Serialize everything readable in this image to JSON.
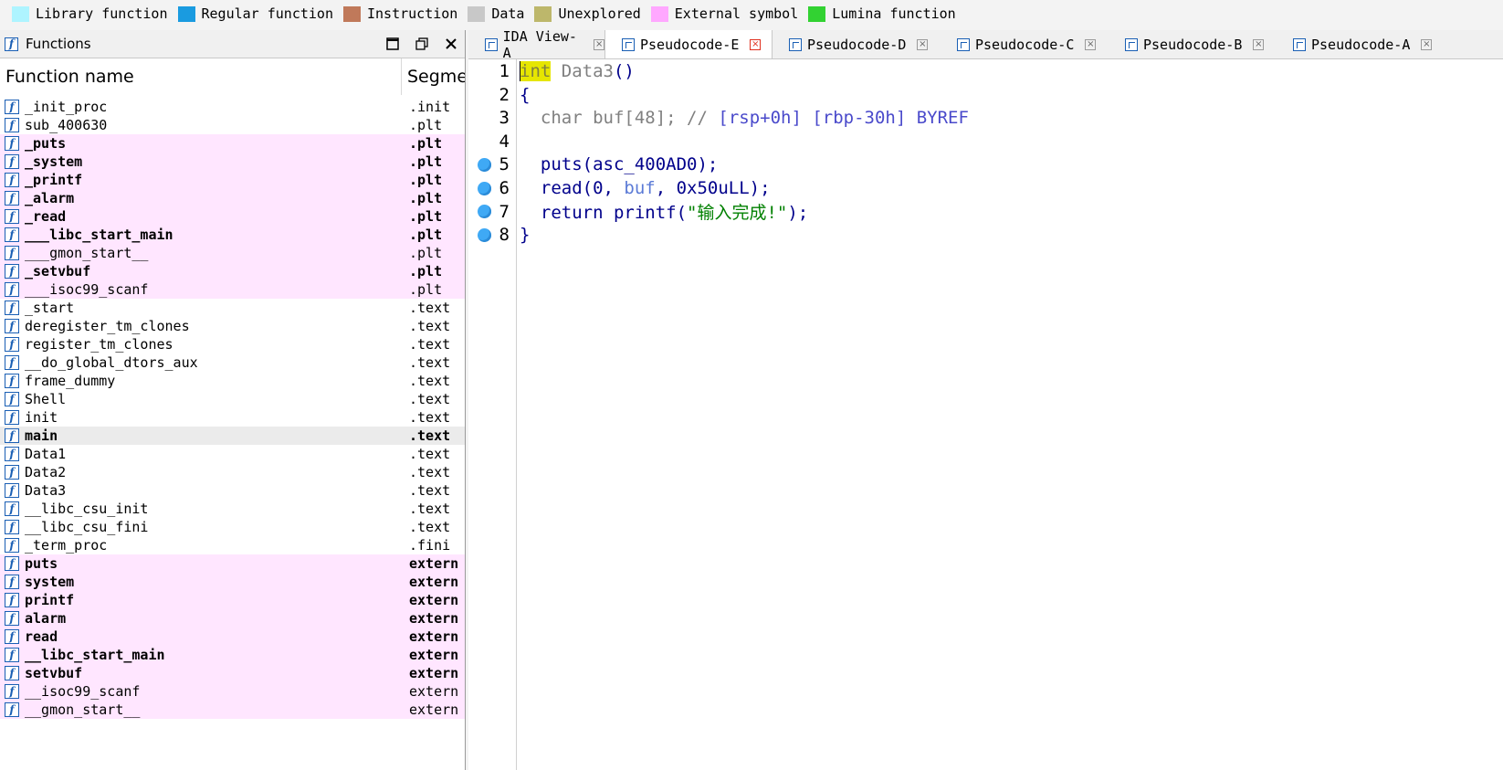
{
  "legend": [
    {
      "label": "Library function",
      "color": "#aef4ff"
    },
    {
      "label": "Regular function",
      "color": "#1a9be0"
    },
    {
      "label": "Instruction",
      "color": "#c0795a"
    },
    {
      "label": "Data",
      "color": "#c8c8c8"
    },
    {
      "label": "Unexplored",
      "color": "#bdb76b"
    },
    {
      "label": "External symbol",
      "color": "#ffa8ff"
    },
    {
      "label": "Lumina function",
      "color": "#32d232"
    }
  ],
  "functions_panel": {
    "title": "Functions",
    "col_name": "Function name",
    "col_segment": "Segme",
    "rows": [
      {
        "name": "_init_proc",
        "seg": ".init",
        "type": "normal"
      },
      {
        "name": "sub_400630",
        "seg": ".plt",
        "type": "normal"
      },
      {
        "name": "_puts",
        "seg": ".plt",
        "type": "ext-bold"
      },
      {
        "name": "_system",
        "seg": ".plt",
        "type": "ext-bold"
      },
      {
        "name": "_printf",
        "seg": ".plt",
        "type": "ext-bold"
      },
      {
        "name": "_alarm",
        "seg": ".plt",
        "type": "ext-bold"
      },
      {
        "name": "_read",
        "seg": ".plt",
        "type": "ext-bold"
      },
      {
        "name": "___libc_start_main",
        "seg": ".plt",
        "type": "ext-bold"
      },
      {
        "name": "___gmon_start__",
        "seg": ".plt",
        "type": "ext"
      },
      {
        "name": "_setvbuf",
        "seg": ".plt",
        "type": "ext-bold"
      },
      {
        "name": "___isoc99_scanf",
        "seg": ".plt",
        "type": "ext"
      },
      {
        "name": "_start",
        "seg": ".text",
        "type": "normal"
      },
      {
        "name": "deregister_tm_clones",
        "seg": ".text",
        "type": "normal"
      },
      {
        "name": "register_tm_clones",
        "seg": ".text",
        "type": "normal"
      },
      {
        "name": "__do_global_dtors_aux",
        "seg": ".text",
        "type": "normal"
      },
      {
        "name": "frame_dummy",
        "seg": ".text",
        "type": "normal"
      },
      {
        "name": "Shell",
        "seg": ".text",
        "type": "normal"
      },
      {
        "name": "init",
        "seg": ".text",
        "type": "normal"
      },
      {
        "name": "main",
        "seg": ".text",
        "type": "sel-bold"
      },
      {
        "name": "Data1",
        "seg": ".text",
        "type": "normal"
      },
      {
        "name": "Data2",
        "seg": ".text",
        "type": "normal"
      },
      {
        "name": "Data3",
        "seg": ".text",
        "type": "normal"
      },
      {
        "name": "__libc_csu_init",
        "seg": ".text",
        "type": "normal"
      },
      {
        "name": "__libc_csu_fini",
        "seg": ".text",
        "type": "normal"
      },
      {
        "name": "_term_proc",
        "seg": ".fini",
        "type": "normal"
      },
      {
        "name": "puts",
        "seg": "extern",
        "type": "ext-bold"
      },
      {
        "name": "system",
        "seg": "extern",
        "type": "ext-bold"
      },
      {
        "name": "printf",
        "seg": "extern",
        "type": "ext-bold"
      },
      {
        "name": "alarm",
        "seg": "extern",
        "type": "ext-bold"
      },
      {
        "name": "read",
        "seg": "extern",
        "type": "ext-bold"
      },
      {
        "name": "__libc_start_main",
        "seg": "extern",
        "type": "ext-bold"
      },
      {
        "name": "setvbuf",
        "seg": "extern",
        "type": "ext-bold"
      },
      {
        "name": "__isoc99_scanf",
        "seg": "extern",
        "type": "ext"
      },
      {
        "name": "__gmon_start__",
        "seg": "extern",
        "type": "ext"
      }
    ]
  },
  "tabs": [
    {
      "label": "IDA View-A",
      "icon": "ida-view-icon",
      "active": false
    },
    {
      "label": "Pseudocode-E",
      "icon": "pseudocode-icon",
      "active": true
    },
    {
      "label": "Pseudocode-D",
      "icon": "pseudocode-icon",
      "active": false
    },
    {
      "label": "Pseudocode-C",
      "icon": "pseudocode-icon",
      "active": false
    },
    {
      "label": "Pseudocode-B",
      "icon": "pseudocode-icon",
      "active": false
    },
    {
      "label": "Pseudocode-A",
      "icon": "pseudocode-icon",
      "active": false
    }
  ],
  "code": {
    "line1_kw": "int",
    "line1_rest": " Data3",
    "line1_paren": "()",
    "line2": "{",
    "line3_a": "  char buf[",
    "line3_num": "48",
    "line3_b": "]; // ",
    "line3_cmt": "[rsp+0h] [rbp-30h] BYREF",
    "line5": "  puts(asc_400AD0);",
    "line6_a": "  read(0, ",
    "line6_var": "buf",
    "line6_b": ", 0x50uLL);",
    "line7_a": "  return printf(",
    "line7_str": "\"输入完成!\"",
    "line7_b": ");",
    "line8": "}",
    "line_numbers": [
      "1",
      "2",
      "3",
      "4",
      "5",
      "6",
      "7",
      "8"
    ],
    "breakpoint_lines": [
      5,
      6,
      7,
      8
    ]
  }
}
